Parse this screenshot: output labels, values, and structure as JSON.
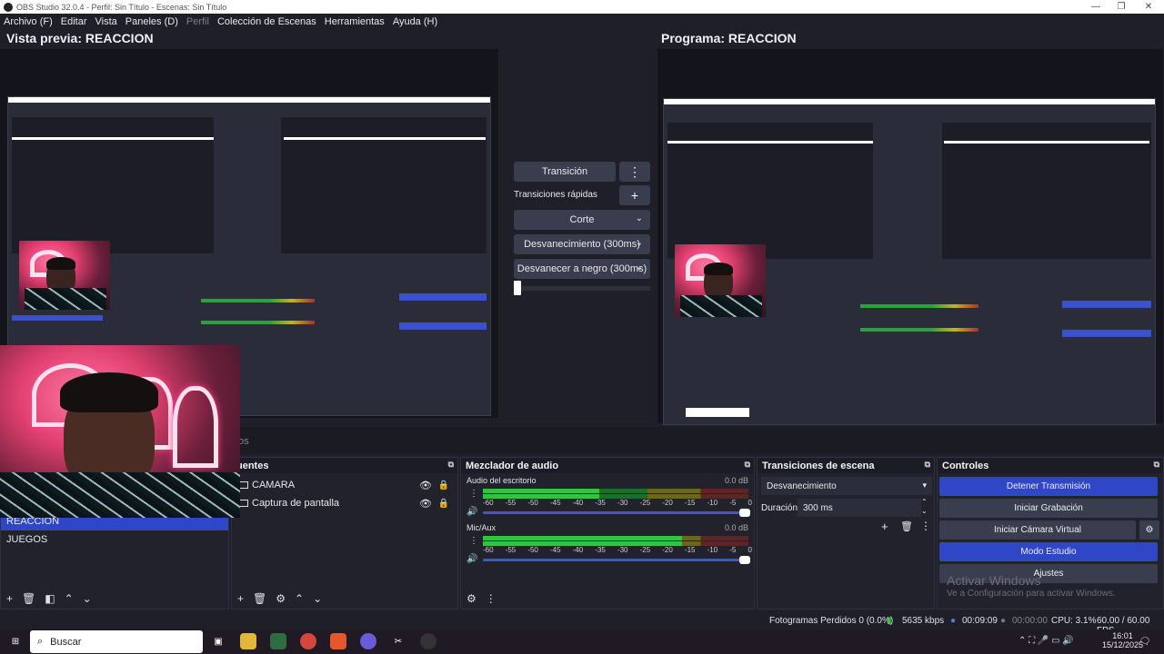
{
  "window": {
    "title": "OBS Studio 32.0.4 - Perfil: Sin Título - Escenas: Sin Título",
    "minimize": "—",
    "restore": "❐",
    "close": "✕"
  },
  "menu": {
    "items": [
      "Archivo (F)",
      "Editar",
      "Vista",
      "Paneles (D)",
      "Perfil",
      "Colección de Escenas",
      "Herramientas",
      "Ayuda (H)"
    ]
  },
  "preview": {
    "label": "Vista previa: REACCION",
    "program_label": "Programa: REACCION"
  },
  "transitions_center": {
    "transition_button": "Transición",
    "quick_transitions_label": "Transiciones rápidas",
    "quick": [
      "Corte",
      "Desvanecimiento (300ms)",
      "Desvanecer a negro (300ms)"
    ],
    "plus_icon": "+",
    "menu_icon": "⋮"
  },
  "scenes": {
    "items": [
      "REACCION",
      "JUEGOS"
    ],
    "selected": "REACCION"
  },
  "sources": {
    "title": "uentes",
    "tab_fragment": "os",
    "items": [
      {
        "name": "CAMARA",
        "visible": true,
        "locked": true
      },
      {
        "name": "Captura de pantalla",
        "visible": true,
        "locked": true
      }
    ]
  },
  "mixer": {
    "title": "Mezclador de audio",
    "channels": [
      {
        "name": "Audio del escritorio",
        "db": "0.0 dB",
        "level": 0.44
      },
      {
        "name": "Mic/Aux",
        "db": "0.0 dB",
        "level": 0.75
      }
    ],
    "scale": [
      "-60",
      "-55",
      "-50",
      "-45",
      "-40",
      "-35",
      "-30",
      "-25",
      "-20",
      "-15",
      "-10",
      "-5",
      "0"
    ]
  },
  "scene_transitions": {
    "title": "Transiciones de escena",
    "selected": "Desvanecimiento",
    "duration_label": "Duración",
    "duration_value": "300 ms"
  },
  "controls": {
    "title": "Controles",
    "stop_stream": "Detener Transmisión",
    "start_record": "Iniciar Grabación",
    "start_vcam": "Iniciar Cámara Virtual",
    "studio_mode": "Modo Estudio",
    "settings": "Ajustes"
  },
  "watermark": {
    "line1": "Activar Windows",
    "line2": "Ve a Configuración para activar Windows."
  },
  "status": {
    "dropped": "Fotogramas Perdidos 0 (0.0%)",
    "bitrate": "5635 kbps",
    "stream_time": "00:09:09",
    "record_time": "00:00:00",
    "cpu": "CPU: 3.1%",
    "fps": "60.00 / 60.00 FPS"
  },
  "taskbar": {
    "search_placeholder": "Buscar",
    "time": "16:01",
    "date": "15/12/2025"
  },
  "colors": {
    "accent_blue": "#2f47c6",
    "meter_green": "#30c445",
    "bg": "#1e1f29"
  }
}
